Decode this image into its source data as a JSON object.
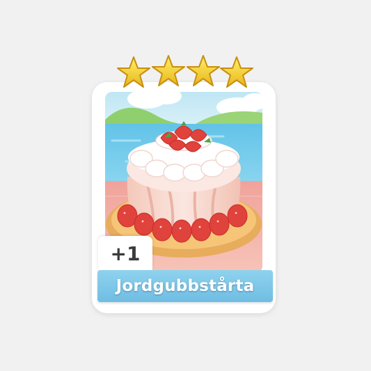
{
  "card": {
    "name": "Jordgubbstårta",
    "count_label": "+1",
    "stars_filled": 4,
    "stars_total": 4,
    "art_icon": "strawberry-cake-icon",
    "colors": {
      "banner": "#7cc6e8",
      "star": "#f3cf2c",
      "background": "#f1f1f1"
    }
  }
}
